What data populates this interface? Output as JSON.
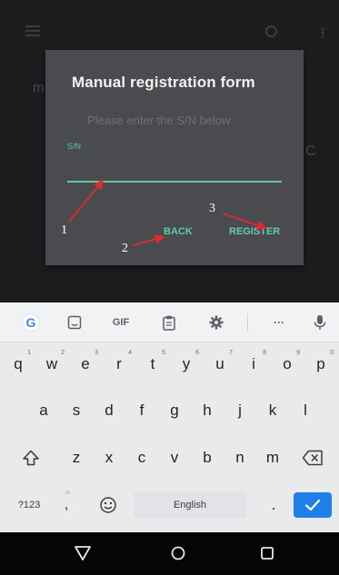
{
  "app": {
    "title": "",
    "fragment_left": "m",
    "fragment_right": "C"
  },
  "dialog": {
    "title": "Manual registration form",
    "subtitle": "Please enter the S/N below",
    "field_label": "S/N",
    "field_value": "",
    "back_label": "BACK",
    "register_label": "REGISTER"
  },
  "annotations": {
    "n1": "1",
    "n2": "2",
    "n3": "3",
    "color": "#e02b2b"
  },
  "keyboard": {
    "toolbar": {
      "google": "G",
      "gif": "GIF",
      "icons": [
        "google-logo-icon",
        "sticker-icon",
        "gif-icon",
        "clipboard-icon",
        "gear-icon",
        "more-icon",
        "microphone-icon"
      ],
      "more": "···"
    },
    "row1": {
      "keys": [
        "q",
        "w",
        "e",
        "r",
        "t",
        "y",
        "u",
        "i",
        "o",
        "p"
      ],
      "hints": [
        "1",
        "2",
        "3",
        "4",
        "5",
        "6",
        "7",
        "8",
        "9",
        "0"
      ]
    },
    "row2": [
      "a",
      "s",
      "d",
      "f",
      "g",
      "h",
      "j",
      "k",
      "l"
    ],
    "row3": [
      "z",
      "x",
      "c",
      "v",
      "b",
      "n",
      "m"
    ],
    "bottom": {
      "symbols": "?123",
      "comma": ",",
      "space": "English",
      "period": "."
    }
  },
  "colors": {
    "accent": "#62c9ad",
    "dialog_bg": "#4a4b4e",
    "enter_key": "#1f7ee8"
  }
}
